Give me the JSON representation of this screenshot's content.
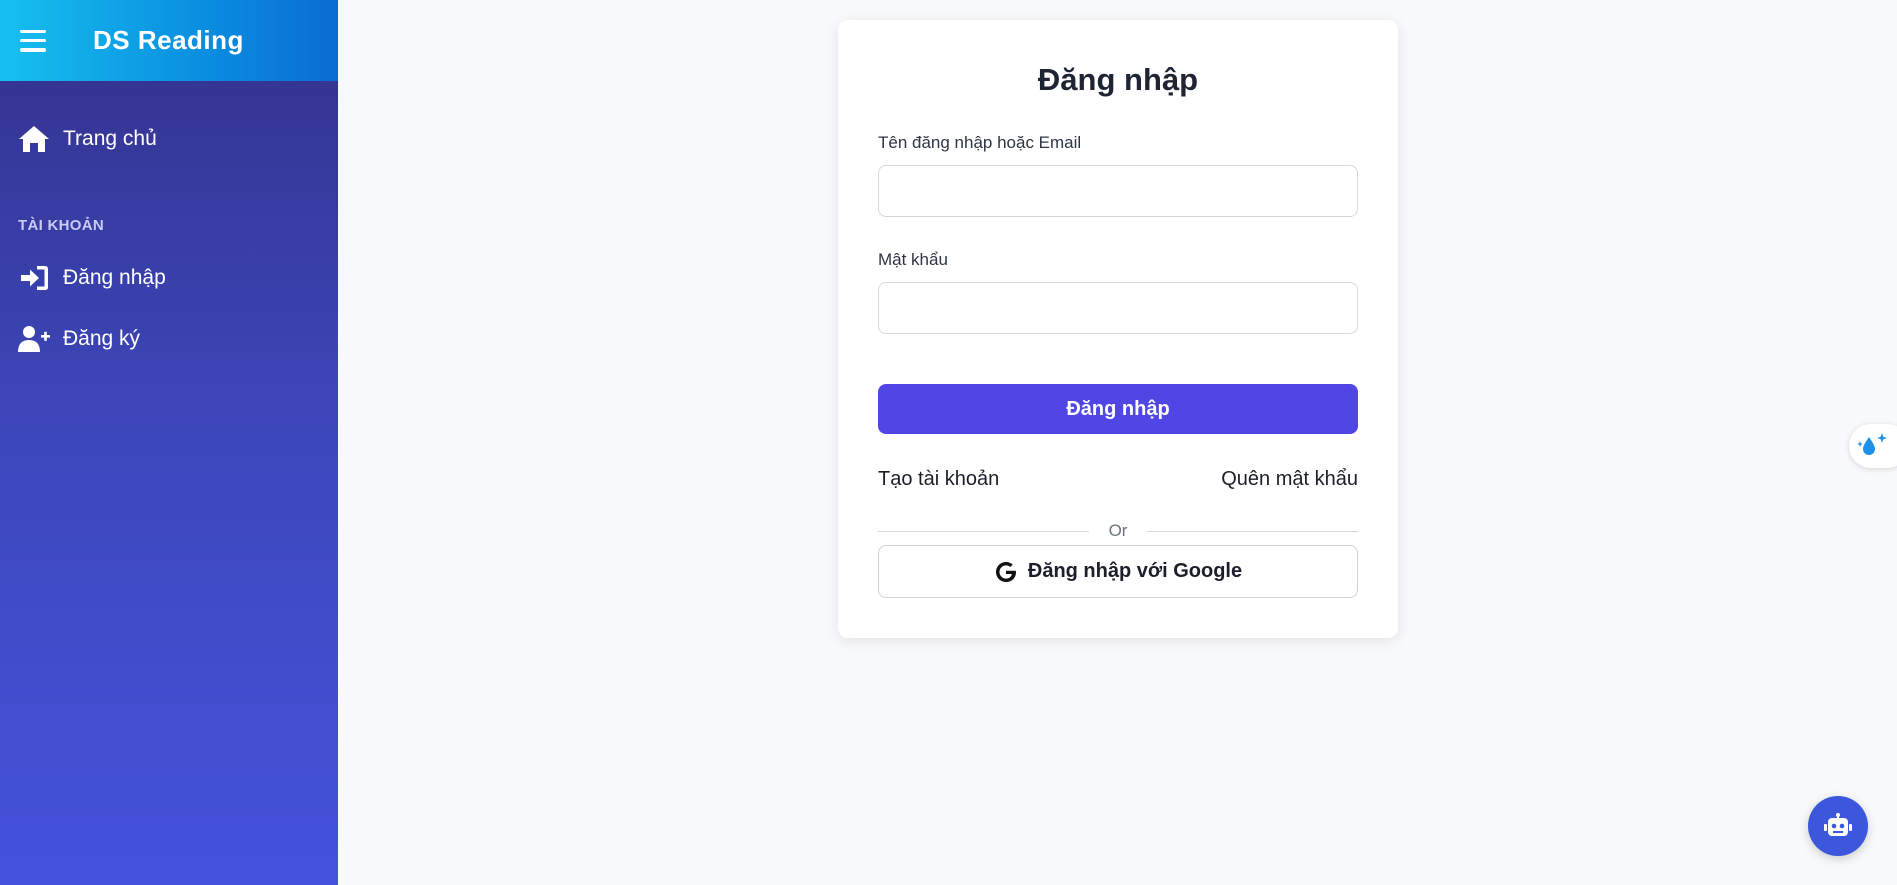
{
  "sidebar": {
    "brand": "DS Reading",
    "home_label": "Trang chủ",
    "section_title": "TÀI KHOẢN",
    "items": [
      {
        "label": "Đăng nhập",
        "icon": "sign-in-icon"
      },
      {
        "label": "Đăng ký",
        "icon": "user-plus-icon"
      }
    ]
  },
  "login": {
    "title": "Đăng nhập",
    "username_label": "Tên đăng nhập hoặc Email",
    "username_value": "",
    "password_label": "Mật khẩu",
    "password_value": "",
    "submit_label": "Đăng nhập",
    "create_account": "Tạo tài khoản",
    "forgot_password": "Quên mật khẩu",
    "or_text": "Or",
    "google_label": "Đăng nhập với Google"
  },
  "colors": {
    "primary": "#4f46e5",
    "header_gradient_start": "#16c0ee",
    "sidebar_top": "#33308a",
    "chat_button": "#3d57dc"
  }
}
